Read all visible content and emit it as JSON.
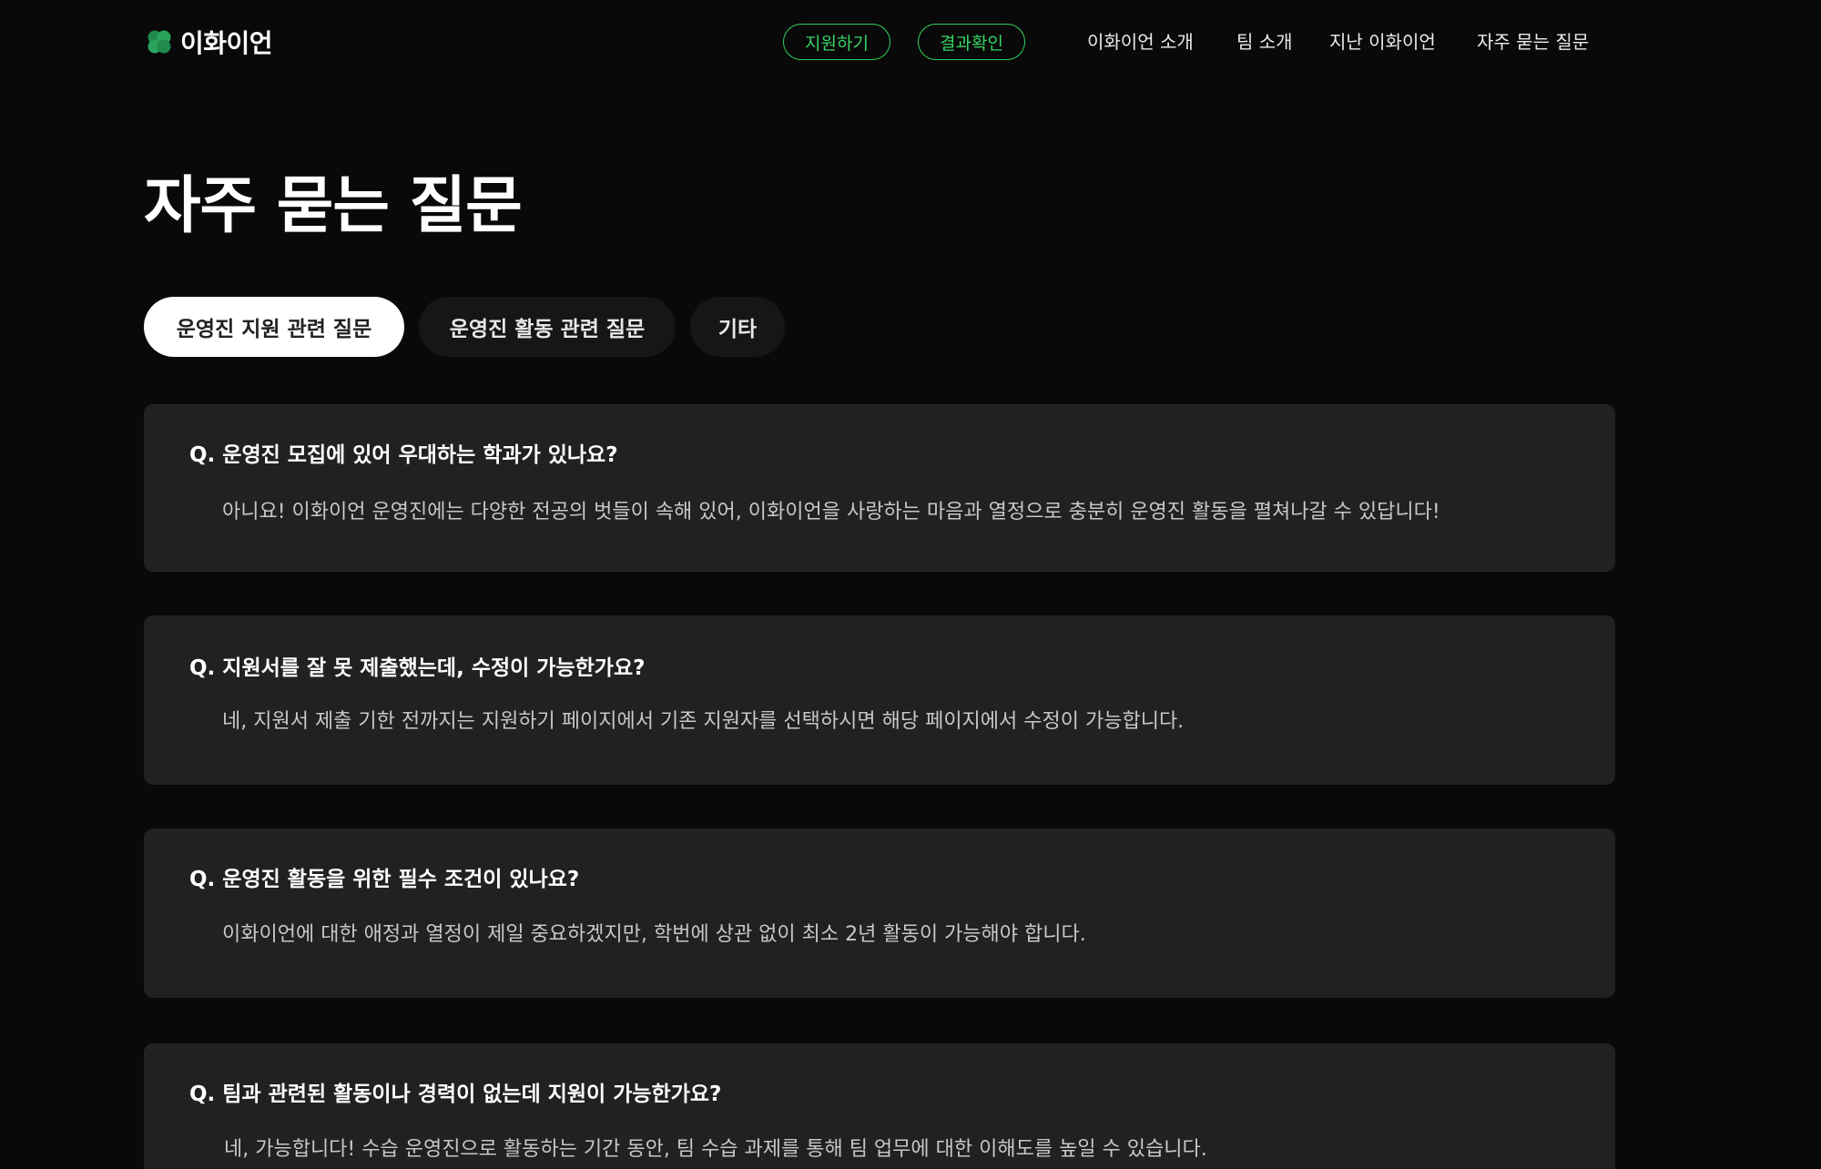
{
  "header": {
    "logo_text": "이화이언",
    "buttons": {
      "apply": "지원하기",
      "result": "결과확인"
    },
    "nav": [
      "이화이언 소개",
      "팀 소개",
      "지난 이화이언",
      "자주 묻는 질문"
    ]
  },
  "main": {
    "title": "자주 묻는 질문",
    "tabs": [
      "운영진 지원 관련 질문",
      "운영진 활동 관련 질문",
      "기타"
    ],
    "active_tab": "운영진 지원 관련 질문",
    "faqs": [
      {
        "q": "Q. 운영진 모집에 있어 우대하는 학과가 있나요?",
        "a": "아니요! 이화이언 운영진에는 다양한 전공의 벗들이 속해 있어, 이화이언을 사랑하는 마음과 열정으로 충분히 운영진 활동을 펼쳐나갈 수 있답니다!"
      },
      {
        "q": "Q. 지원서를 잘 못 제출했는데, 수정이 가능한가요?",
        "a": "네, 지원서 제출 기한 전까지는 지원하기 페이지에서 기존 지원자를 선택하시면 해당 페이지에서 수정이 가능합니다."
      },
      {
        "q": "Q. 운영진 활동을 위한 필수 조건이 있나요?",
        "a": "이화이언에 대한 애정과 열정이 제일 중요하겠지만, 학번에 상관 없이 최소 2년 활동이 가능해야 합니다."
      },
      {
        "q": "Q. 팀과 관련된 활동이나 경력이 없는데 지원이 가능한가요?",
        "a": "네, 가능합니다! 수습 운영진으로 활동하는 기간 동안, 팀 수습 과제를 통해 팀 업무에 대한 이해도를 높일 수 있습니다."
      }
    ]
  },
  "colors": {
    "background": "#090909",
    "card": "#212121",
    "accent_green": "#36d463",
    "active_tab_bg": "#ffffff"
  },
  "icons": {
    "logo": "clover-icon"
  }
}
